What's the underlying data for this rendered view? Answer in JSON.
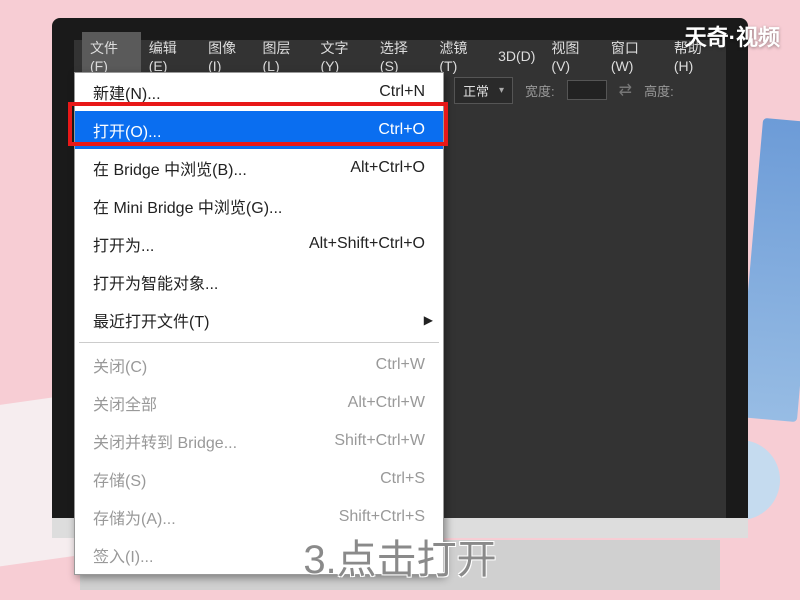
{
  "watermark": "天奇·视频",
  "caption": "3.点击打开",
  "menubar": [
    {
      "label": "文件(F)",
      "active": true
    },
    {
      "label": "编辑(E)"
    },
    {
      "label": "图像(I)"
    },
    {
      "label": "图层(L)"
    },
    {
      "label": "文字(Y)"
    },
    {
      "label": "选择(S)"
    },
    {
      "label": "滤镜(T)"
    },
    {
      "label": "3D(D)"
    },
    {
      "label": "视图(V)"
    },
    {
      "label": "窗口(W)"
    },
    {
      "label": "帮助(H)"
    }
  ],
  "toolbar": {
    "mode_label": "正常",
    "width_label": "宽度:",
    "height_label": "高度:"
  },
  "file_menu": [
    {
      "label": "新建(N)...",
      "shortcut": "Ctrl+N"
    },
    {
      "label": "打开(O)...",
      "shortcut": "Ctrl+O",
      "highlighted": true
    },
    {
      "label": "在 Bridge 中浏览(B)...",
      "shortcut": "Alt+Ctrl+O"
    },
    {
      "label": "在 Mini Bridge 中浏览(G)...",
      "shortcut": ""
    },
    {
      "label": "打开为...",
      "shortcut": "Alt+Shift+Ctrl+O"
    },
    {
      "label": "打开为智能对象...",
      "shortcut": ""
    },
    {
      "label": "最近打开文件(T)",
      "shortcut": "",
      "submenu": true
    },
    {
      "separator": true
    },
    {
      "label": "关闭(C)",
      "shortcut": "Ctrl+W",
      "disabled": true
    },
    {
      "label": "关闭全部",
      "shortcut": "Alt+Ctrl+W",
      "disabled": true
    },
    {
      "label": "关闭并转到 Bridge...",
      "shortcut": "Shift+Ctrl+W",
      "disabled": true
    },
    {
      "label": "存储(S)",
      "shortcut": "Ctrl+S",
      "disabled": true
    },
    {
      "label": "存储为(A)...",
      "shortcut": "Shift+Ctrl+S",
      "disabled": true
    },
    {
      "label": "签入(I)...",
      "shortcut": "",
      "disabled": true
    }
  ]
}
